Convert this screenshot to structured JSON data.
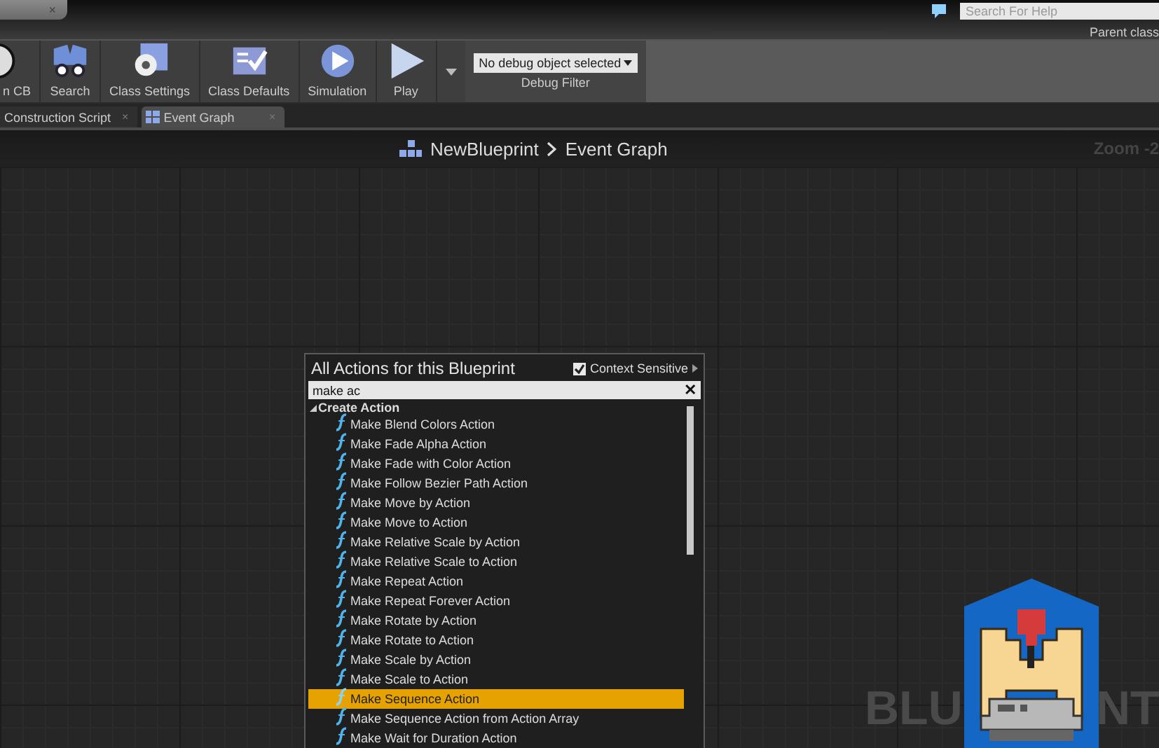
{
  "top_bar": {
    "tab_close": "×",
    "help_search": {
      "placeholder": "Search For Help"
    },
    "parent_class": "Parent class"
  },
  "toolbar": {
    "buttons": [
      {
        "kind": "sphere",
        "label": "n CB"
      },
      {
        "kind": "search",
        "label": "Search"
      },
      {
        "kind": "settings",
        "label": "Class Settings"
      },
      {
        "kind": "defaults",
        "label": "Class Defaults"
      },
      {
        "kind": "simulation",
        "label": "Simulation"
      },
      {
        "kind": "play",
        "label": "Play"
      }
    ],
    "debug_filter": {
      "value": "No debug object selected",
      "label": "Debug Filter"
    }
  },
  "tabs": [
    {
      "label": "Construction Script",
      "close": "×",
      "selected": false
    },
    {
      "label": "Event Graph",
      "close": "×",
      "selected": true
    }
  ],
  "breadcrumb": [
    "NewBlueprint",
    "Event Graph"
  ],
  "zoom": "Zoom -2",
  "action_menu": {
    "title": "All Actions for this Blueprint",
    "context_sensitive": {
      "label": "Context Sensitive",
      "checked": true
    },
    "search": {
      "value": "make ac",
      "clear": "✕"
    },
    "category": {
      "label": "Create Action",
      "expanded": true
    },
    "items": [
      {
        "label": "Make Blend Colors Action",
        "selected": false
      },
      {
        "label": "Make Fade Alpha Action",
        "selected": false
      },
      {
        "label": "Make Fade with Color Action",
        "selected": false
      },
      {
        "label": "Make Follow Bezier Path Action",
        "selected": false
      },
      {
        "label": "Make Move by Action",
        "selected": false
      },
      {
        "label": "Make Move to Action",
        "selected": false
      },
      {
        "label": "Make Relative Scale by Action",
        "selected": false
      },
      {
        "label": "Make Relative Scale to Action",
        "selected": false
      },
      {
        "label": "Make Repeat Action",
        "selected": false
      },
      {
        "label": "Make Repeat Forever Action",
        "selected": false
      },
      {
        "label": "Make Rotate by Action",
        "selected": false
      },
      {
        "label": "Make Rotate to Action",
        "selected": false
      },
      {
        "label": "Make Scale by Action",
        "selected": false
      },
      {
        "label": "Make Scale to Action",
        "selected": false
      },
      {
        "label": "Make Sequence Action",
        "selected": true
      },
      {
        "label": "Make Sequence Action from Action Array",
        "selected": false
      },
      {
        "label": "Make Wait for Duration Action",
        "selected": false
      }
    ]
  },
  "graph_label": [
    "BLU",
    "NT"
  ]
}
